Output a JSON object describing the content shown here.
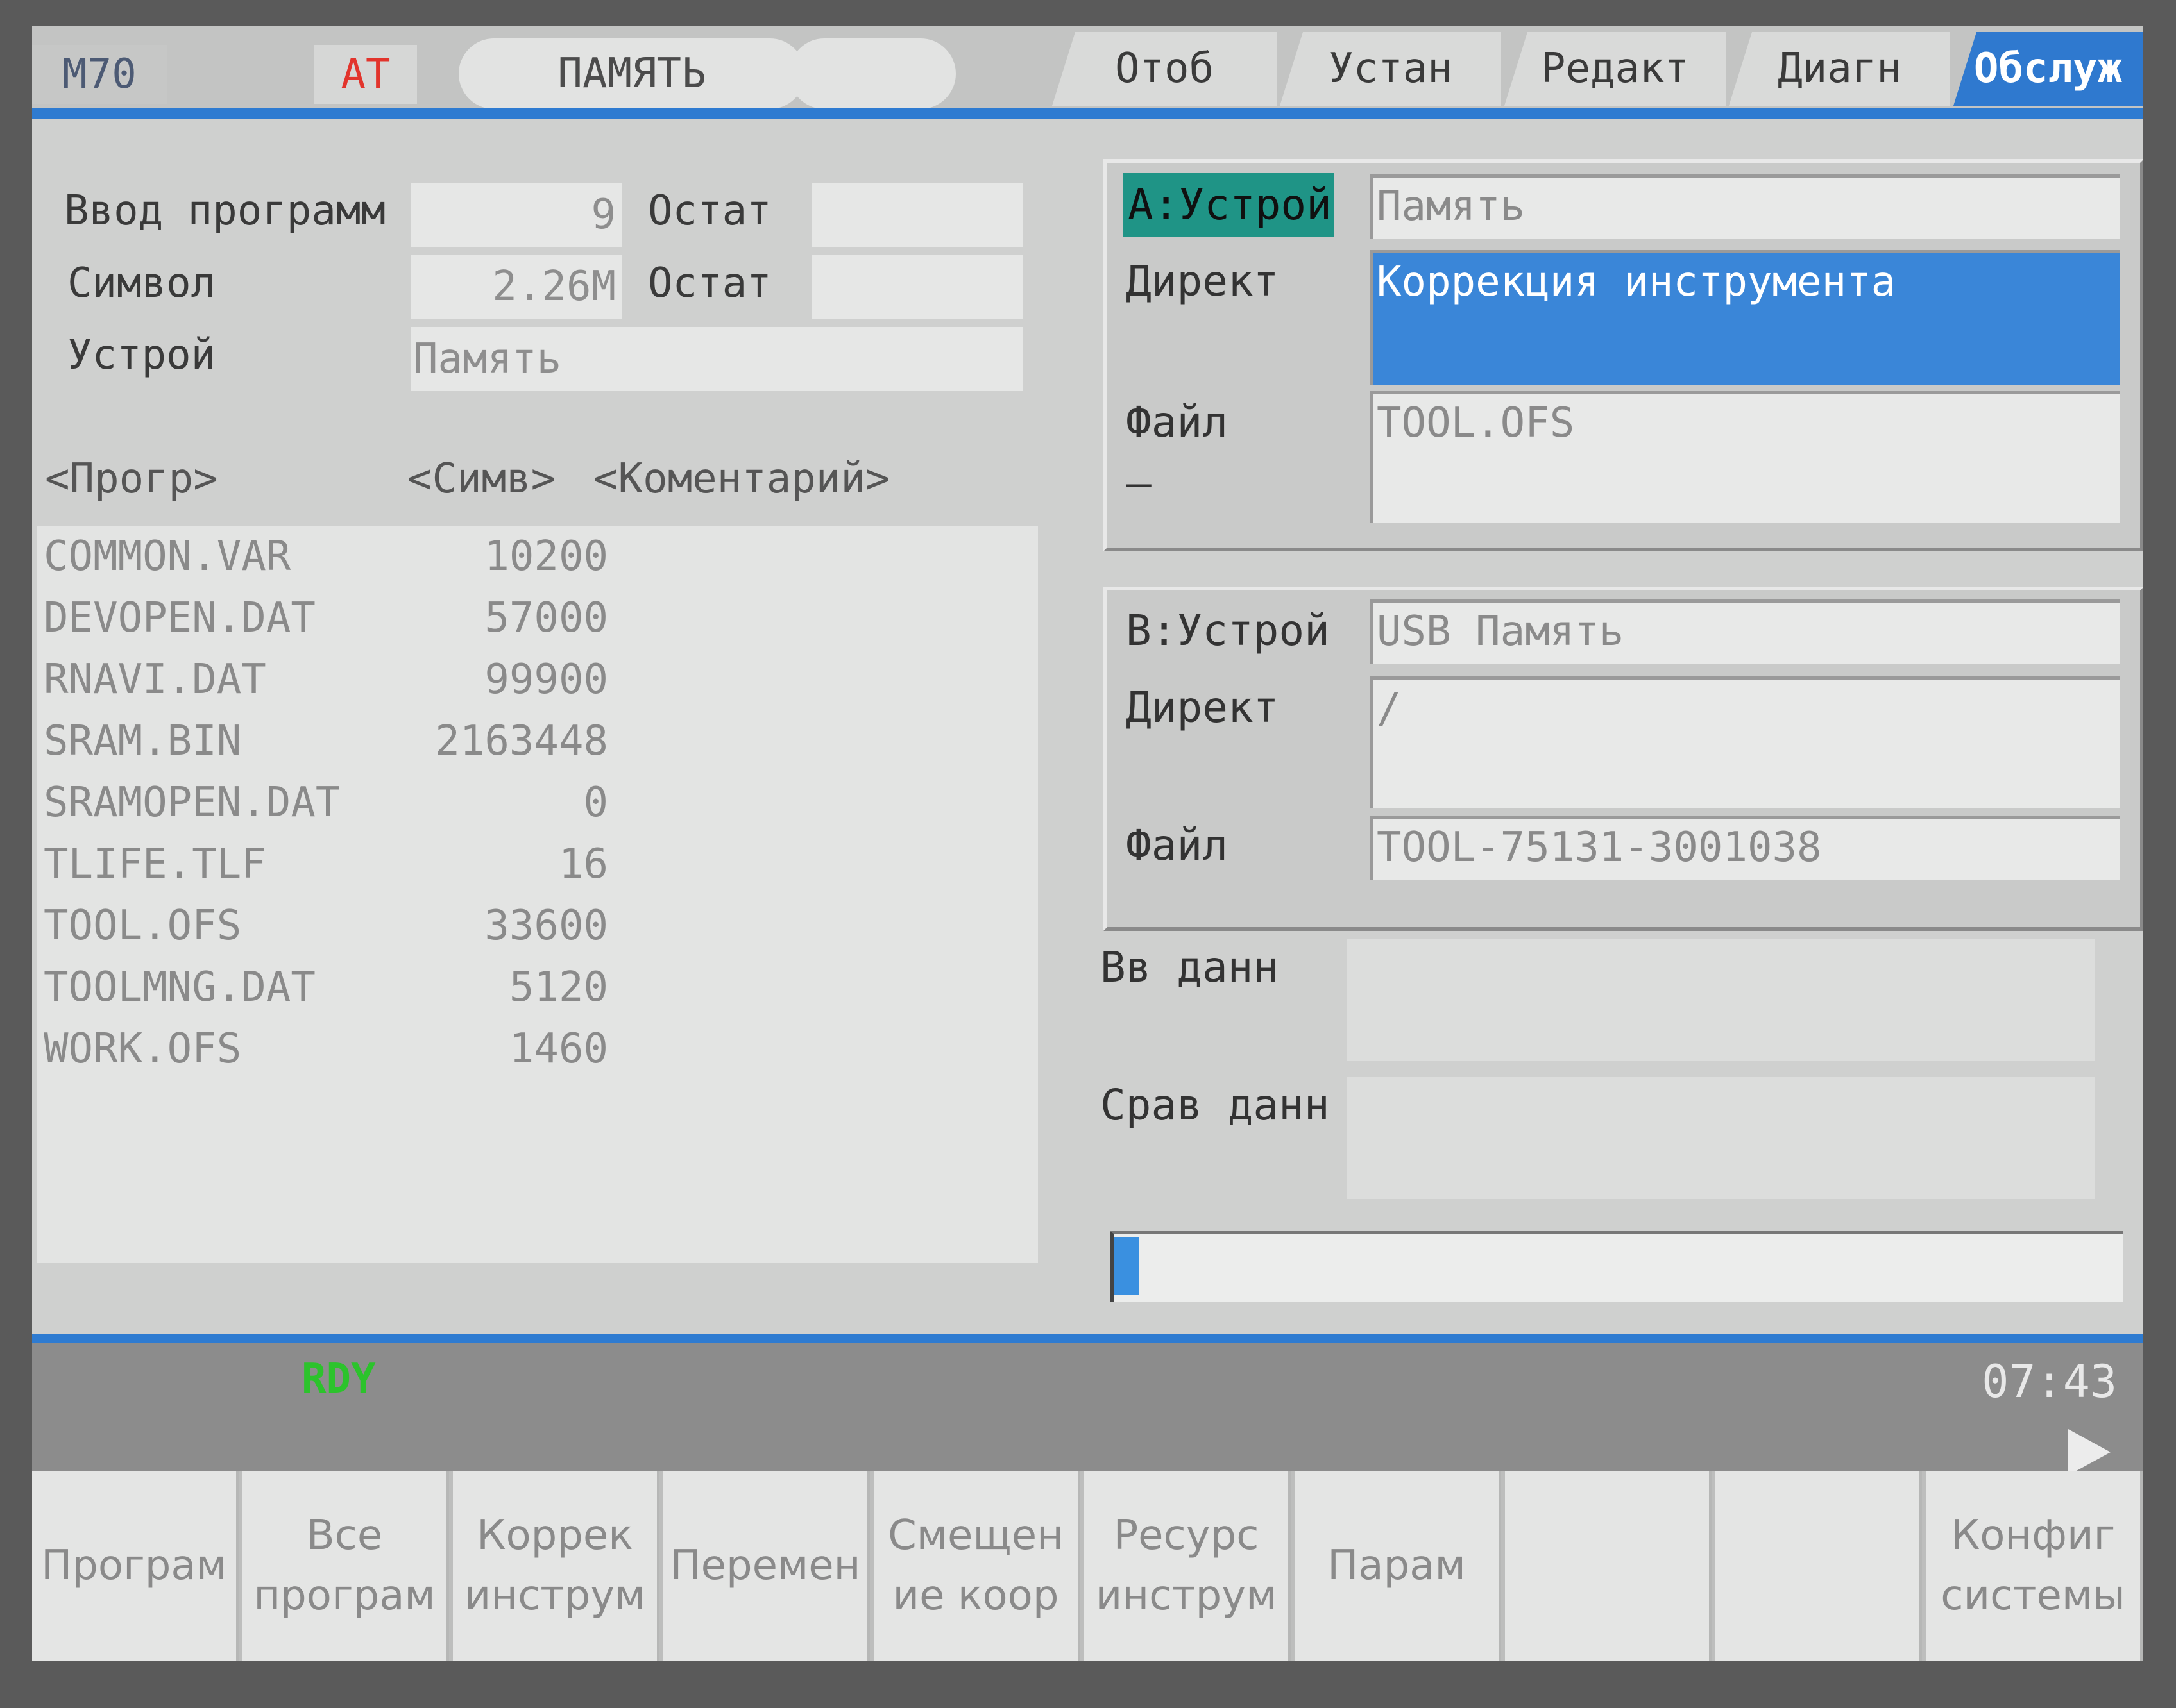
{
  "header": {
    "model": "M70",
    "alarm": "AT",
    "mode": "ПАМЯТЬ",
    "tabs": [
      {
        "label": "Отоб",
        "active": false
      },
      {
        "label": "Устан",
        "active": false
      },
      {
        "label": "Редакт",
        "active": false
      },
      {
        "label": "Диагн",
        "active": false
      },
      {
        "label": "Обслуж",
        "active": true
      }
    ]
  },
  "left": {
    "programs_label": "Ввод программ",
    "programs_value": "9",
    "remain1_label": "Остат",
    "remain1_value": "",
    "chars_label": "Символ",
    "chars_value": "2.26M",
    "remain2_label": "Остат",
    "remain2_value": "",
    "device_label": "Устрой",
    "device_value": "Память",
    "col_prog": "<Прогр>",
    "col_size": "<Симв>",
    "col_comment": "<Коментарий>",
    "files": [
      {
        "name": "COMMON.VAR",
        "size": "10200"
      },
      {
        "name": "DEVOPEN.DAT",
        "size": "57000"
      },
      {
        "name": "RNAVI.DAT",
        "size": "99900"
      },
      {
        "name": "SRAM.BIN",
        "size": "2163448"
      },
      {
        "name": "SRAMOPEN.DAT",
        "size": "0"
      },
      {
        "name": "TLIFE.TLF",
        "size": "16"
      },
      {
        "name": "TOOL.OFS",
        "size": "33600"
      },
      {
        "name": "TOOLMNG.DAT",
        "size": "5120"
      },
      {
        "name": "WORK.OFS",
        "size": "1460"
      }
    ]
  },
  "deviceA": {
    "label": "А:Устрой",
    "device": "Память",
    "dir_label": "Директ",
    "dir_value": "Коррекция инструмента",
    "file_label": "Файл",
    "file_value": "TOOL.OFS",
    "dash": "–"
  },
  "deviceB": {
    "label": "В:Устрой",
    "device": "USB Память",
    "dir_label": "Директ",
    "dir_value": "/",
    "file_label": "Файл",
    "file_value": "TOOL-75131-3001038"
  },
  "data": {
    "input_label": "Вв данн",
    "compare_label": "Срав данн",
    "progress": 0.01
  },
  "status": {
    "ready": "RDY",
    "time": "07:43"
  },
  "softkeys": [
    "Програм",
    "Все\nпрограм",
    "Коррек\nинструм",
    "Перемен",
    "Смещен\nие коор",
    "Ресурс\nинструм",
    "Парам",
    "",
    "",
    "Конфиг\nсистемы"
  ]
}
